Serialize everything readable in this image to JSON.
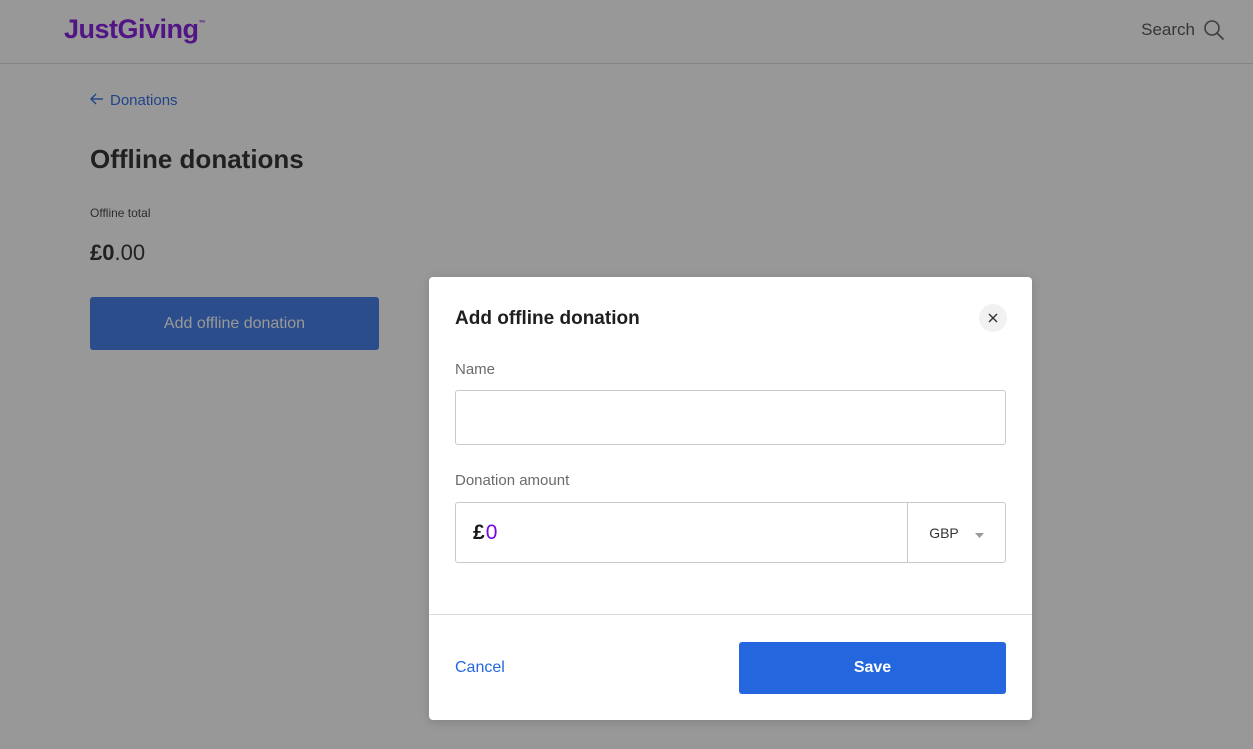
{
  "header": {
    "logo_text": "JustGiving",
    "logo_mark": "™",
    "search_label": "Search",
    "search_icon": "search-icon"
  },
  "main": {
    "back_link_label": "Donations",
    "back_icon": "arrow-left-icon",
    "page_title": "Offline donations",
    "total_label": "Offline total",
    "total_integer": "£0",
    "total_decimals": ".00",
    "add_button_label": "Add offline donation"
  },
  "modal": {
    "title": "Add offline donation",
    "close_icon": "close-icon",
    "name_label": "Name",
    "name_value": "",
    "amount_label": "Donation amount",
    "currency_symbol": "£",
    "amount_value": "0",
    "currency_selected": "GBP",
    "dropdown_icon": "caret-down-icon",
    "cancel_label": "Cancel",
    "save_label": "Save"
  },
  "colors": {
    "brand_purple": "#7a04dd",
    "primary_blue": "#2466dd",
    "link_blue": "#2467de",
    "overlay": "rgba(40,40,40,0.48)"
  }
}
